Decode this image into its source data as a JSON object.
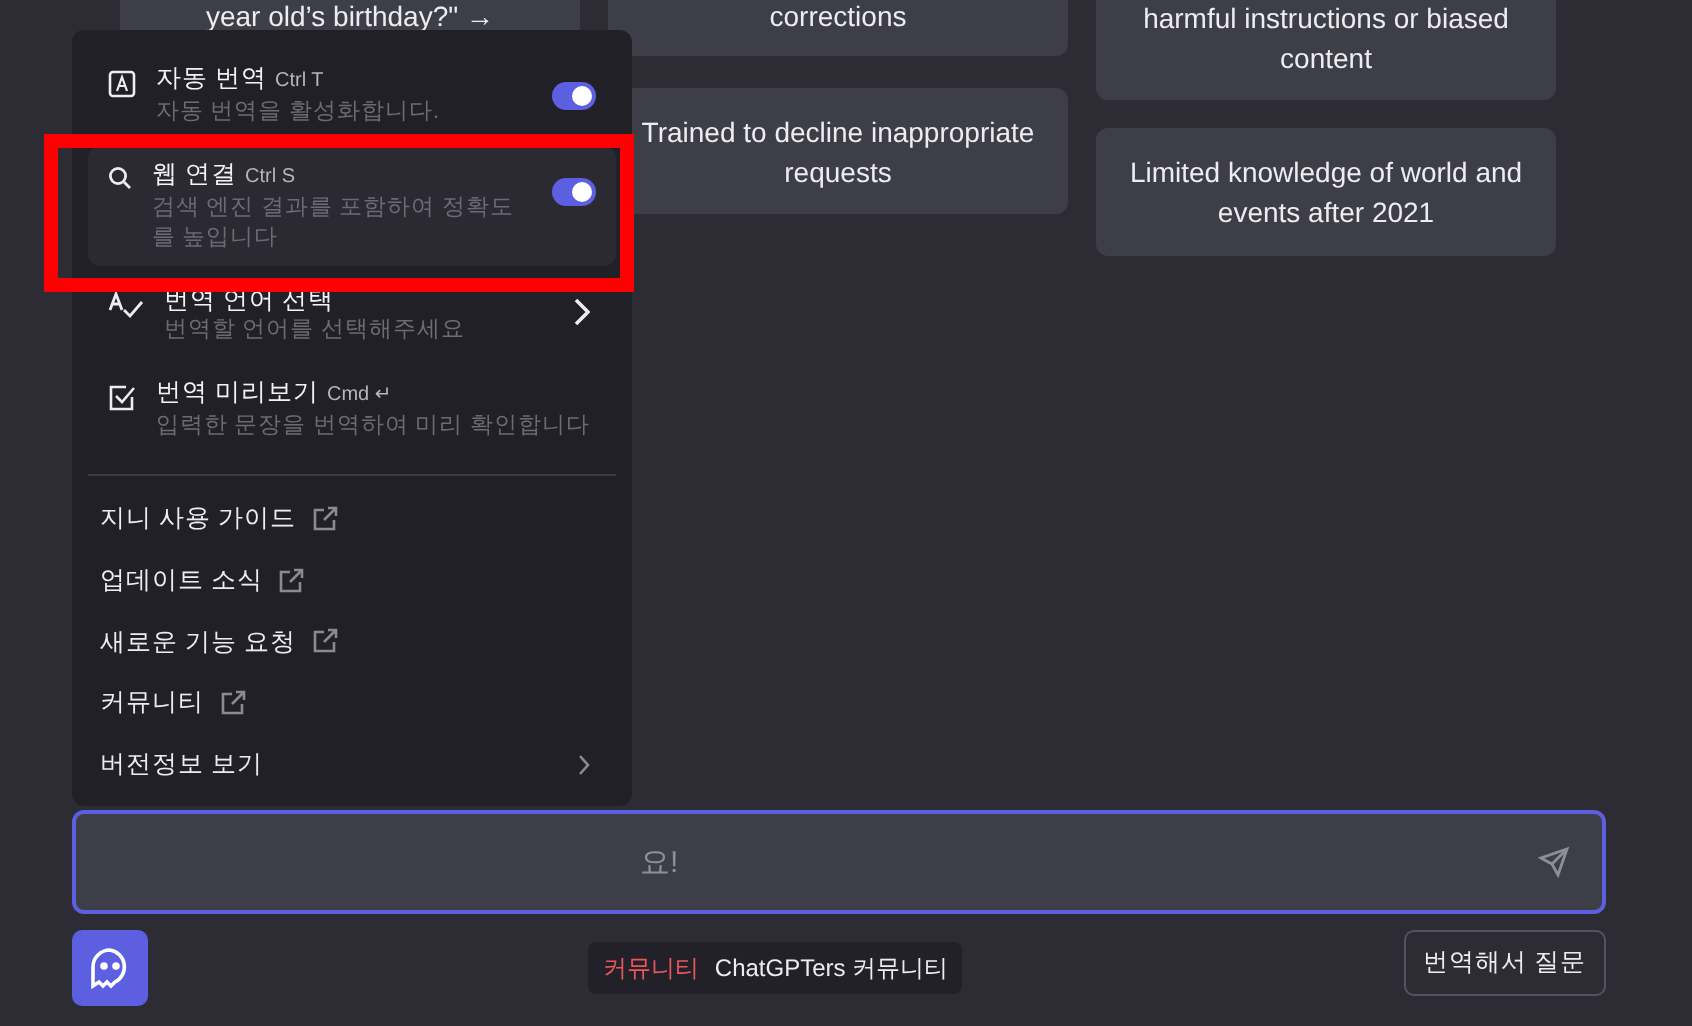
{
  "example_columns": [
    {
      "cards": [
        "year old’s birthday?\" →"
      ]
    },
    {
      "cards": [
        "corrections",
        "Trained to decline inappropriate requests"
      ]
    },
    {
      "cards": [
        "harmful instructions or biased content",
        "Limited knowledge of world and events after 2021"
      ]
    }
  ],
  "menu": {
    "options": [
      {
        "kind": "toggle",
        "title": "자동 번역",
        "shortcut": "Ctrl T",
        "description": "자동 번역을 활성화합니다.",
        "on": true,
        "highlighted": false
      },
      {
        "kind": "toggle",
        "title": "웹 연결",
        "shortcut": "Ctrl S",
        "description": "검색 엔진 결과를 포함하여 정확도를 높입니다",
        "on": true,
        "highlighted": true
      },
      {
        "kind": "submenu",
        "title": "번역 언어 선택",
        "description": "번역할 언어를 선택해주세요",
        "highlighted": false
      },
      {
        "kind": "plain",
        "title": "번역 미리보기",
        "shortcut": "Cmd ↵",
        "description": "입력한 문장을 번역하여 미리 확인합니다",
        "highlighted": false
      }
    ],
    "links": [
      {
        "kind": "external",
        "label": "지니 사용 가이드"
      },
      {
        "kind": "external",
        "label": "업데이트 소식"
      },
      {
        "kind": "external",
        "label": "새로운 기능 요청"
      },
      {
        "kind": "external",
        "label": "커뮤니티"
      },
      {
        "kind": "submenu",
        "label": "버전정보 보기"
      }
    ]
  },
  "prompt": {
    "placeholder": "요!"
  },
  "community_tag": {
    "label": "커뮤니티",
    "text": "ChatGPTers 커뮤니티"
  },
  "translate_button": "번역해서 질문"
}
